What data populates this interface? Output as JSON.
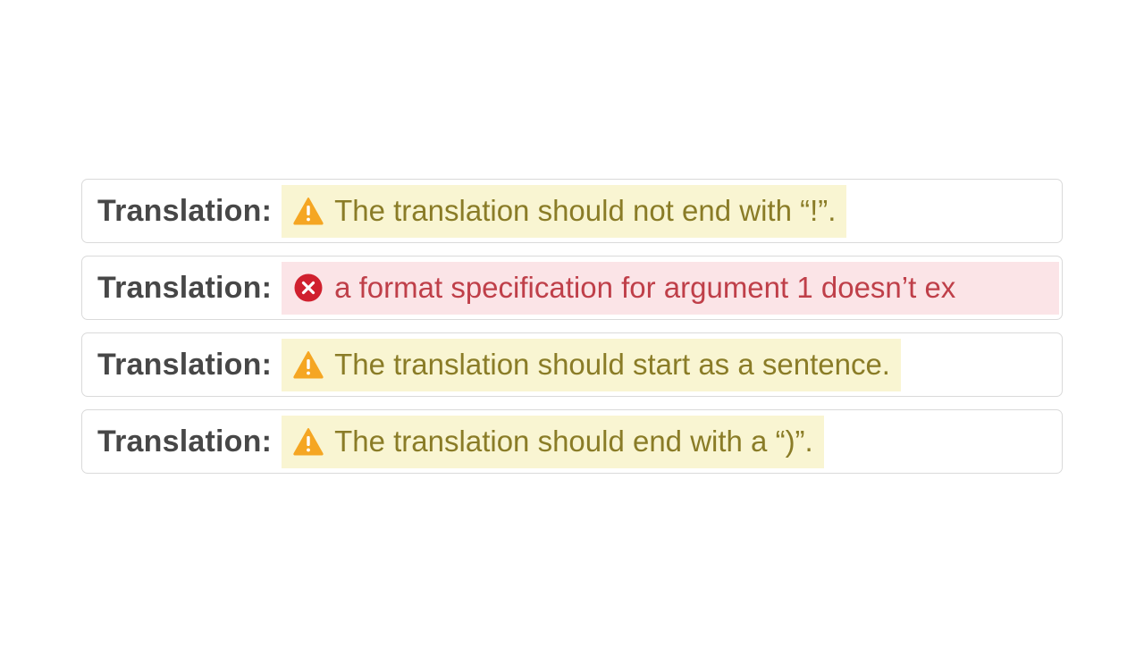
{
  "rows": [
    {
      "label": "Translation:",
      "severity": "warning",
      "icon": "warning-triangle-icon",
      "message": "The translation should not end with “!”."
    },
    {
      "label": "Translation:",
      "severity": "error",
      "icon": "error-circle-icon",
      "message": "a format specification for argument 1 doesn’t ex"
    },
    {
      "label": "Translation:",
      "severity": "warning",
      "icon": "warning-triangle-icon",
      "message": "The translation should start as a sentence."
    },
    {
      "label": "Translation:",
      "severity": "warning",
      "icon": "warning-triangle-icon",
      "message": "The translation should end with a “)”."
    }
  ],
  "colors": {
    "warning_bg": "#f9f5d2",
    "warning_text": "#8a7c27",
    "warning_icon": "#f5a623",
    "error_bg": "#fbe4e7",
    "error_text": "#bf3f49",
    "error_icon": "#d0202e",
    "label_text": "#474747",
    "row_border": "#dadada"
  }
}
